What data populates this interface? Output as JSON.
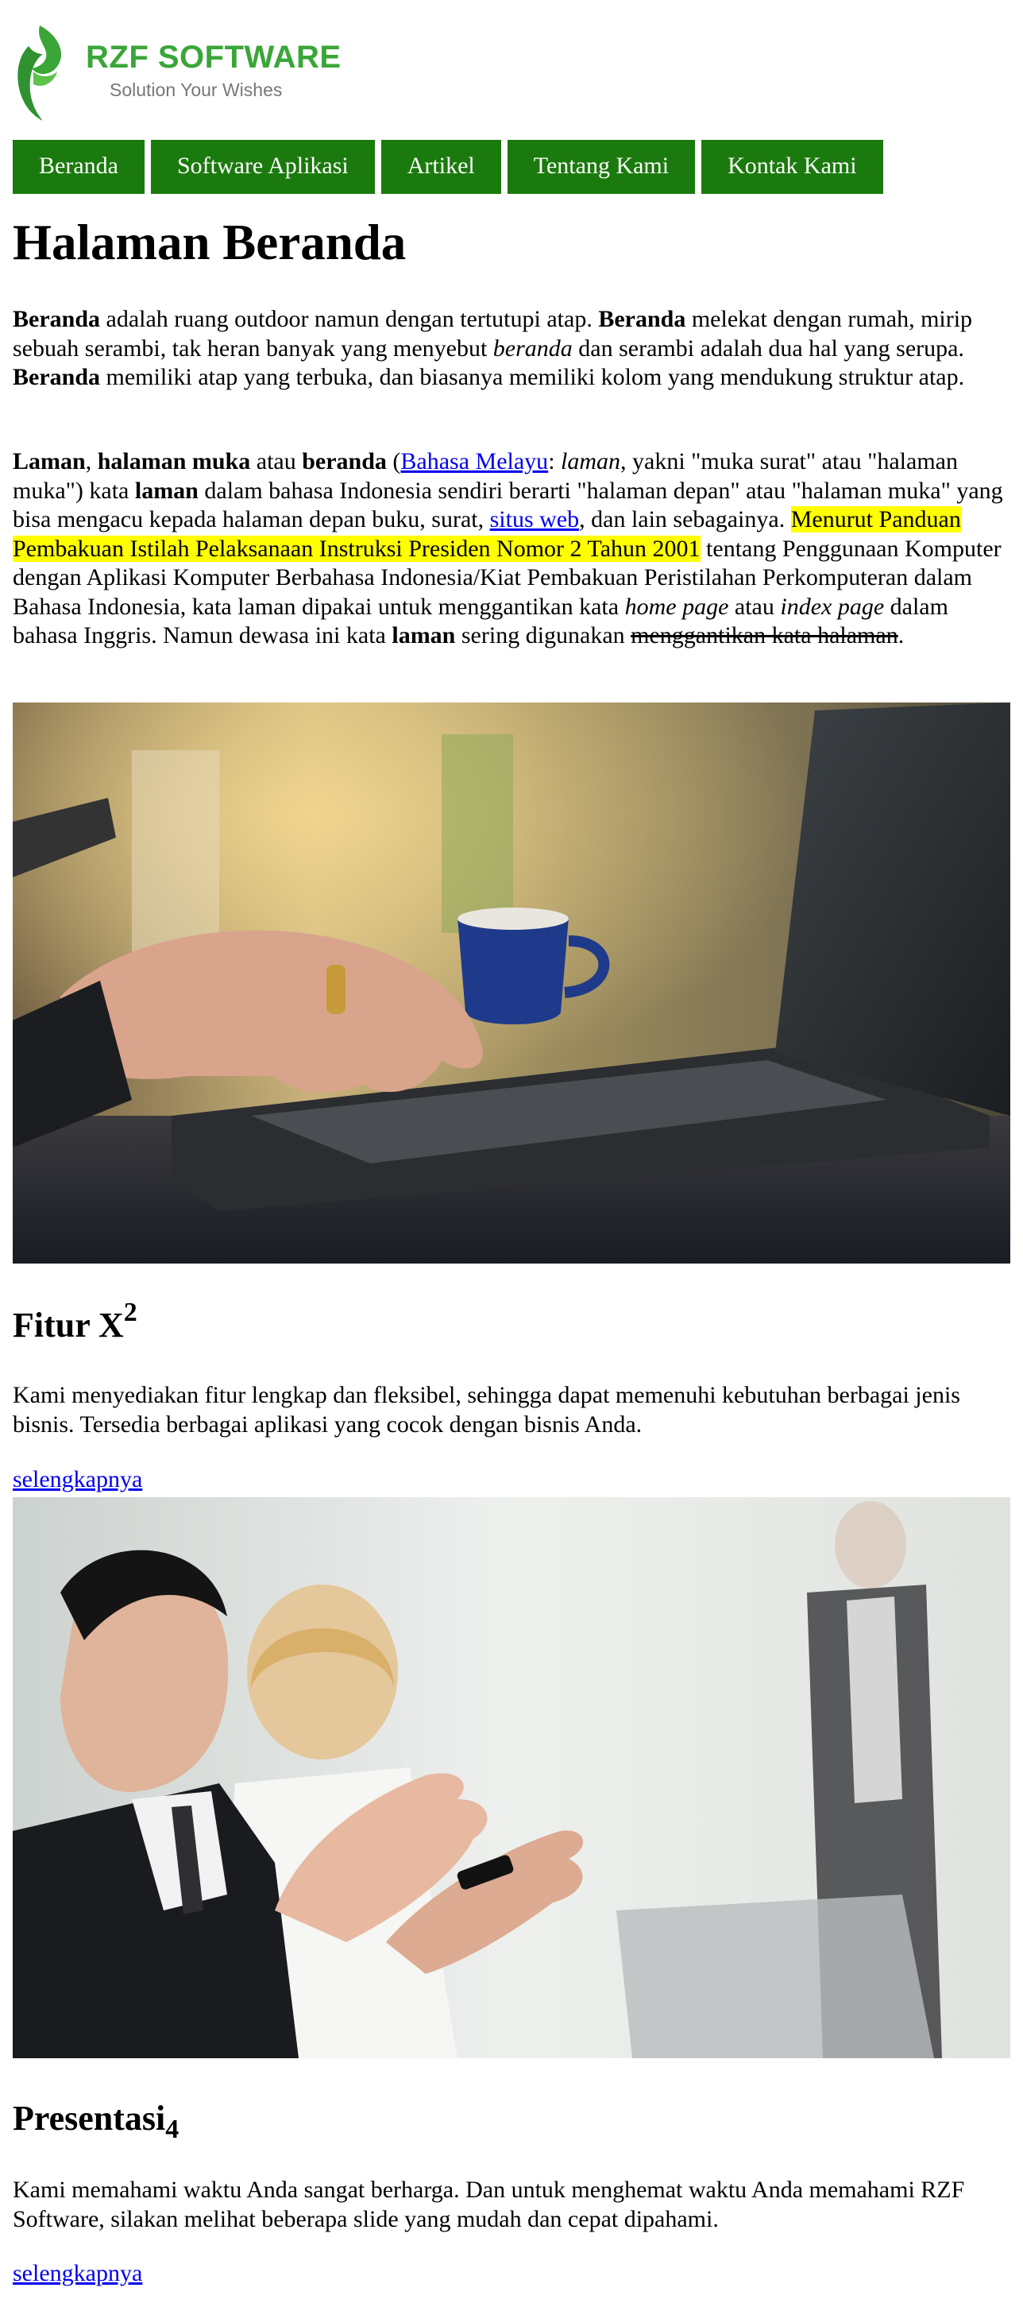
{
  "header": {
    "logo_brand": "RZF SOFTWARE",
    "logo_tagline": "Solution Your Wishes"
  },
  "nav": {
    "items": [
      "Beranda",
      "Software Aplikasi",
      "Artikel",
      "Tentang Kami",
      "Kontak Kami"
    ]
  },
  "main": {
    "title": "Halaman Beranda",
    "para1": {
      "t1": "Beranda",
      "t2": " adalah ruang outdoor namun dengan tertutupi atap. ",
      "t3": "Beranda",
      "t4": " melekat dengan rumah, mirip sebuah serambi, tak heran banyak yang menyebut ",
      "t5": "beranda",
      "t6": " dan serambi adalah dua hal yang serupa. ",
      "t7": "Beranda",
      "t8": " memiliki atap yang terbuka, dan biasanya memiliki kolom yang mendukung struktur atap."
    },
    "para2": {
      "t1": "Laman",
      "t2": ", ",
      "t3": "halaman muka",
      "t4": " atau ",
      "t5": "beranda",
      "t6": " (",
      "link1": "Bahasa Melayu",
      "t7": ": ",
      "t8": "laman",
      "t9": ", yakni \"muka surat\" atau \"halaman muka\") kata ",
      "t10": "laman",
      "t11": " dalam bahasa Indonesia sendiri berarti \"halaman depan\" atau \"halaman muka\" yang bisa mengacu kepada halaman depan buku, surat, ",
      "link2": "situs web",
      "t12": ", dan lain sebagainya. ",
      "highlight": "Menurut Panduan Pembakuan Istilah Pelaksanaan Instruksi Presiden Nomor 2 Tahun 2001",
      "t13": " tentang Penggunaan Komputer dengan Aplikasi Komputer Berbahasa Indonesia/Kiat Pembakuan Peristilahan Perkomputeran dalam Bahasa Indonesia, kata laman dipakai untuk menggantikan kata ",
      "t14": "home page",
      "t15": " atau ",
      "t16": "index page",
      "t17": " dalam bahasa Inggris. Namun dewasa ini kata ",
      "t18": "laman",
      "t19": " sering digunakan ",
      "strike": "menggantikan kata halaman",
      "t20": "."
    }
  },
  "sections": [
    {
      "title": "Fitur X",
      "title_mark": "2",
      "text": "Kami menyediakan fitur lengkap dan fleksibel, sehingga dapat memenuhi kebutuhan berbagai jenis bisnis. Tersedia berbagai aplikasi yang cocok dengan bisnis Anda.",
      "link": "selengkapnya"
    },
    {
      "title": "Presentasi",
      "title_mark": "4",
      "text": "Kami memahami waktu Anda sangat berharga. Dan untuk menghemat waktu Anda memahami RZF Software, silakan melihat beberapa slide yang mudah dan cepat dipahami.",
      "link": "selengkapnya"
    }
  ],
  "colors": {
    "nav_bg": "#1b7a0d",
    "logo_green": "#3aa638",
    "link": "#0000ee",
    "highlight": "#ffff00"
  }
}
